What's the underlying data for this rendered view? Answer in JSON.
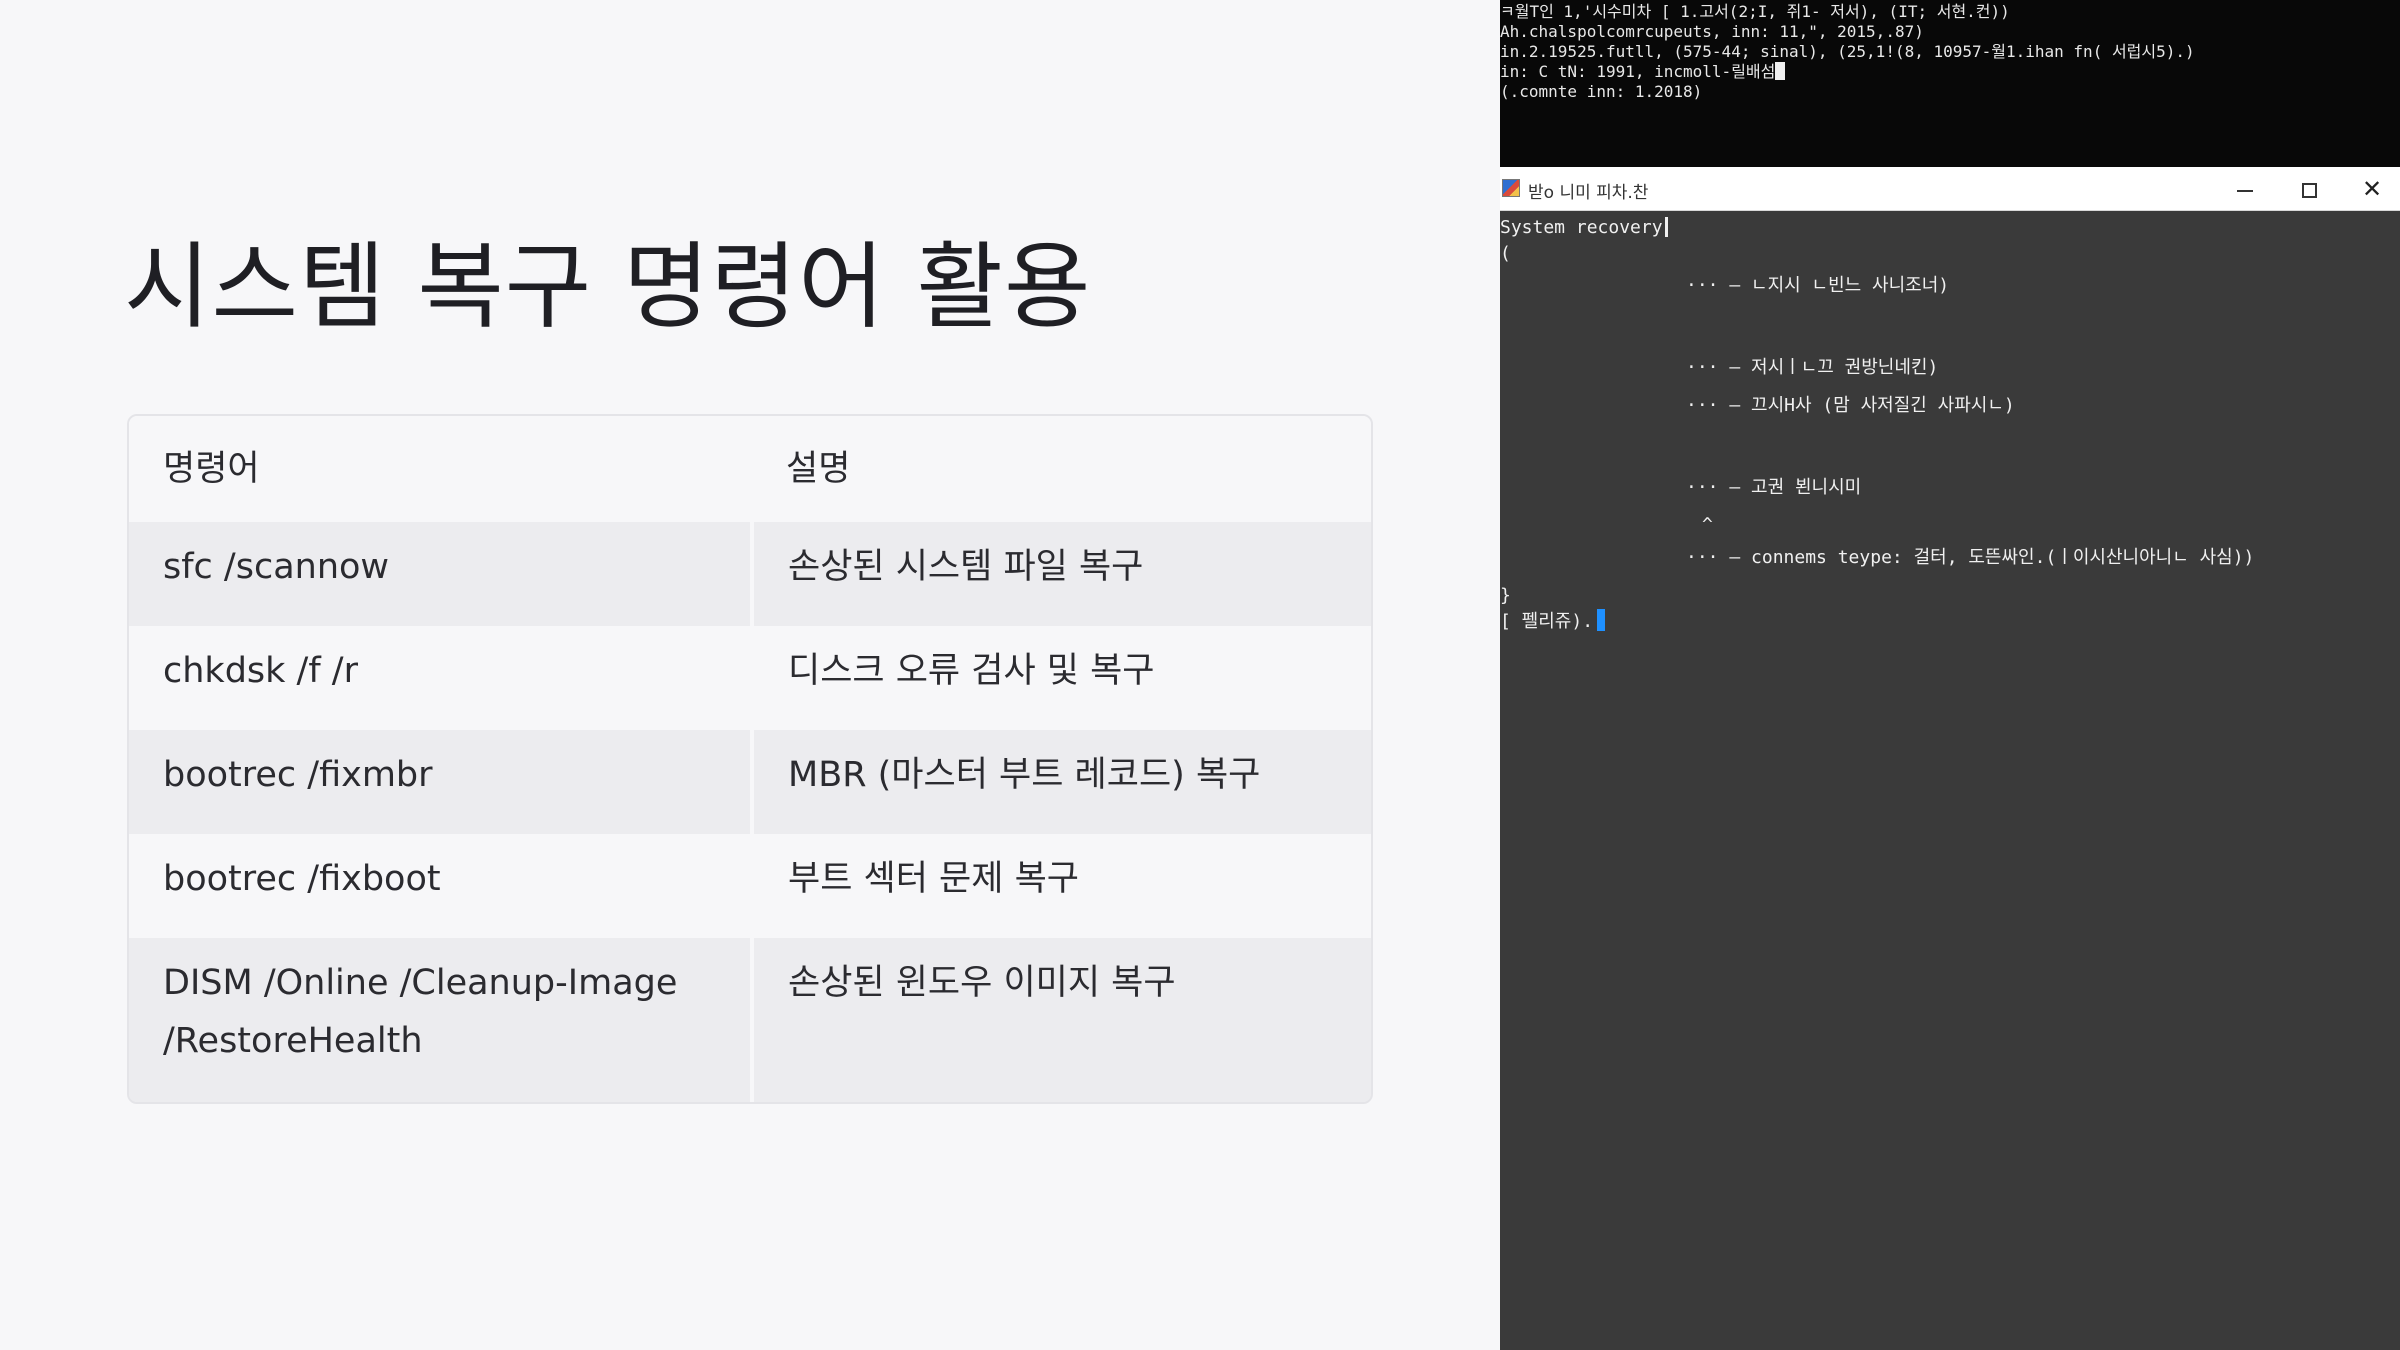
{
  "slide": {
    "title": "시스템 복구 명령어 활용",
    "table": {
      "headers": [
        "명령어",
        "설명"
      ],
      "rows": [
        {
          "command": "sfc /scannow",
          "description": "손상된 시스템 파일 복구"
        },
        {
          "command": "chkdsk /f /r",
          "description": "디스크 오류 검사 및 복구"
        },
        {
          "command": "bootrec /fixmbr",
          "description": "MBR (마스터 부트 레코드) 복구"
        },
        {
          "command": "bootrec /fixboot",
          "description": "부트 섹터 문제 복구"
        },
        {
          "command_line1": "DISM /Online /Cleanup-Image",
          "command_line2": "/RestoreHealth",
          "description": "손상된 윈도우 이미지 복구"
        }
      ]
    }
  },
  "terminal_top": {
    "lines": [
      "ㅋ월T인 1,'시수미차 [ 1.고서(2;I, 쥐1- 저서), (IT; 서현.컨))",
      "Ah.chalspolcomrcupeuts, inn: 11,\", 2015,.87)",
      "in.2.19525.futll, (575-44; sinal), (25,1!(8, 10957-월1.ihan fn( 서럽시5).)",
      "in: C tN: 1991, incmoll-릴배섬",
      "(.comnte inn: 1.2018)"
    ]
  },
  "window": {
    "title": "받o 니미 피차.찬",
    "minimize": "minimize",
    "maximize": "maximize",
    "close": "close"
  },
  "terminal": {
    "heading": "System recovery",
    "brace_open": "(",
    "items": [
      "··· – ㄴ지시 ㄴ빈느 사니조너)",
      "··· – 저시ㅣㄴ끄 권방닌네킨)",
      "··· – 끄시H사 (맘 사저질긴 사파시ㄴ)",
      "··· – 고권 뵌니시미",
      "··· – connems teype: 걸터, 도뜬싸인.(ㅣ이시산니아니ㄴ 사심))"
    ],
    "caret": "^",
    "brace_close": "}",
    "prompt": "[ 펠리쥬)."
  }
}
